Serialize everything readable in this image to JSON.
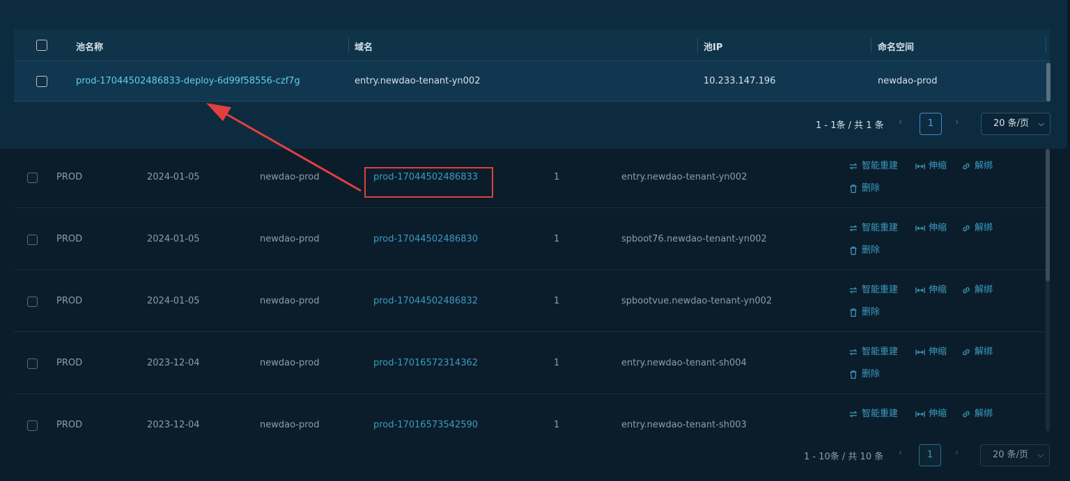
{
  "background_table": {
    "rows": [
      {
        "env": "PROD",
        "date": "2024-01-05",
        "namespace": "newdao-prod",
        "name": "prod-17044502486833",
        "count": "1",
        "domain": "entry.newdao-tenant-yn002"
      },
      {
        "env": "PROD",
        "date": "2024-01-05",
        "namespace": "newdao-prod",
        "name": "prod-17044502486830",
        "count": "1",
        "domain": "spboot76.newdao-tenant-yn002"
      },
      {
        "env": "PROD",
        "date": "2024-01-05",
        "namespace": "newdao-prod",
        "name": "prod-17044502486832",
        "count": "1",
        "domain": "spbootvue.newdao-tenant-yn002"
      },
      {
        "env": "PROD",
        "date": "2023-12-04",
        "namespace": "newdao-prod",
        "name": "prod-17016572314362",
        "count": "1",
        "domain": "entry.newdao-tenant-sh004"
      },
      {
        "env": "PROD",
        "date": "2023-12-04",
        "namespace": "newdao-prod",
        "name": "prod-17016573542590",
        "count": "1",
        "domain": "entry.newdao-tenant-sh003"
      }
    ],
    "actions": {
      "rebuild": "智能重建",
      "scale": "伸缩",
      "unbind": "解绑",
      "delete": "删除"
    },
    "pagination": {
      "total": "1 - 10条 / 共 10 条",
      "prev": "‹",
      "page": "1",
      "next": "›",
      "size": "20 条/页"
    }
  },
  "popup": {
    "headers": {
      "pool_name": "池名称",
      "domain": "域名",
      "pool_ip": "池IP",
      "namespace": "命名空间"
    },
    "row": {
      "pool_name": "prod-17044502486833-deploy-6d99f58556-czf7g",
      "domain": "entry.newdao-tenant-yn002",
      "pool_ip": "10.233.147.196",
      "namespace": "newdao-prod"
    },
    "pagination": {
      "total": "1 - 1条 / 共 1 条",
      "prev": "‹",
      "page": "1",
      "next": "›",
      "size": "20 条/页"
    }
  },
  "colors": {
    "link": "#3b9bc4",
    "popup_link": "#5fd0e8",
    "annotation": "#e04040"
  }
}
